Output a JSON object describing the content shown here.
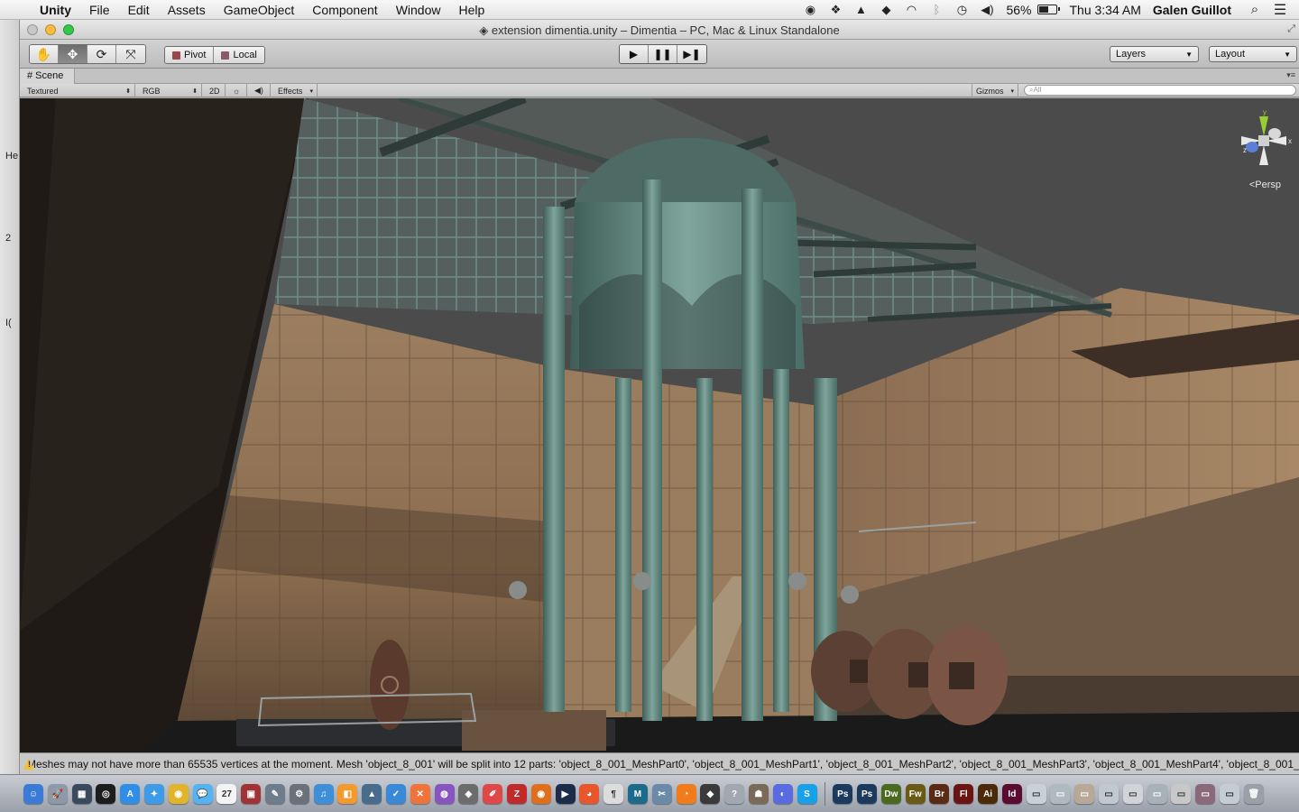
{
  "menubar": {
    "app": "Unity",
    "items": [
      "File",
      "Edit",
      "Assets",
      "GameObject",
      "Component",
      "Window",
      "Help"
    ],
    "battery_percent": "56%",
    "battery_level": 0.56,
    "clock": "Thu 3:34 AM",
    "user": "Galen Guillot",
    "status_icons": [
      "evernote-icon",
      "dropbox-icon",
      "google-drive-icon",
      "creative-cloud-icon",
      "wifi-icon",
      "bluetooth-icon",
      "time-machine-icon",
      "volume-icon"
    ]
  },
  "window": {
    "title": "extension dimentia.unity – Dimentia – PC, Mac & Linux Standalone"
  },
  "toolbar": {
    "tools": [
      "hand-tool",
      "move-tool",
      "rotate-tool",
      "scale-tool"
    ],
    "pivot_label": "Pivot",
    "local_label": "Local",
    "play_controls": [
      "play",
      "pause",
      "step"
    ],
    "layers_label": "Layers",
    "layout_label": "Layout"
  },
  "scene_tab": {
    "label": "Scene",
    "render_mode": "Textured",
    "color_mode": "RGB",
    "toggle_2d": "2D",
    "effects_label": "Effects",
    "gizmos_label": "Gizmos",
    "search_placeholder": "All",
    "camera_mode": "Persp",
    "axis_x": "x",
    "axis_y": "y",
    "axis_z": "z"
  },
  "behind_window_text": [
    "He",
    "2",
    "I("
  ],
  "console": {
    "message": "Meshes may not have more than 65535 vertices at the moment. Mesh 'object_8_001' will be split into 12 parts: 'object_8_001_MeshPart0', 'object_8_001_MeshPart1', 'object_8_001_MeshPart2', 'object_8_001_MeshPart3', 'object_8_001_MeshPart4', 'object_8_001_"
  },
  "dock": {
    "apps": [
      {
        "name": "finder",
        "color": "#3b7bd6",
        "glyph": "☺"
      },
      {
        "name": "launchpad",
        "color": "#8d98a8",
        "glyph": "🚀"
      },
      {
        "name": "mission-control",
        "color": "#3a4a5e",
        "glyph": "▦"
      },
      {
        "name": "dashboard",
        "color": "#1d1d1d",
        "glyph": "◎"
      },
      {
        "name": "app-store",
        "color": "#2f8fe8",
        "glyph": "A"
      },
      {
        "name": "safari",
        "color": "#3e9be8",
        "glyph": "✦"
      },
      {
        "name": "chrome",
        "color": "#e0b52a",
        "glyph": "◉"
      },
      {
        "name": "messages",
        "color": "#55b3f3",
        "glyph": "💬"
      },
      {
        "name": "calendar",
        "color": "#f4f4f4",
        "glyph": "27"
      },
      {
        "name": "photo-booth",
        "color": "#a03434",
        "glyph": "▣"
      },
      {
        "name": "preview",
        "color": "#6d7d8c",
        "glyph": "✎"
      },
      {
        "name": "system-preferences",
        "color": "#6b7079",
        "glyph": "⚙"
      },
      {
        "name": "itunes",
        "color": "#3f8fd8",
        "glyph": "♫"
      },
      {
        "name": "ibooks",
        "color": "#f29a2e",
        "glyph": "◧"
      },
      {
        "name": "iphoto",
        "color": "#4a6c8c",
        "glyph": "▲"
      },
      {
        "name": "wunderlist",
        "color": "#3a88d8",
        "glyph": "✓"
      },
      {
        "name": "xampp",
        "color": "#f0743a",
        "glyph": "✕"
      },
      {
        "name": "transmit",
        "color": "#8854c0",
        "glyph": "◍"
      },
      {
        "name": "network-utility",
        "color": "#6c6c6c",
        "glyph": "◈"
      },
      {
        "name": "script-editor",
        "color": "#e04848",
        "glyph": "✐"
      },
      {
        "name": "filezilla",
        "color": "#c02a2a",
        "glyph": "Z"
      },
      {
        "name": "sublime",
        "color": "#e06e1e",
        "glyph": "◉"
      },
      {
        "name": "quicktime",
        "color": "#1e2c4c",
        "glyph": "▶"
      },
      {
        "name": "firefox",
        "color": "#e8562c",
        "glyph": "◕"
      },
      {
        "name": "textedit",
        "color": "#dcdcdc",
        "glyph": "¶"
      },
      {
        "name": "maya",
        "color": "#1c6b8a",
        "glyph": "M"
      },
      {
        "name": "blender-tools",
        "color": "#6a8aa8",
        "glyph": "✂"
      },
      {
        "name": "blender",
        "color": "#f07c1c",
        "glyph": "◔"
      },
      {
        "name": "unity",
        "color": "#3a3a3a",
        "glyph": "◆"
      },
      {
        "name": "help",
        "color": "#a0a8b0",
        "glyph": "?"
      },
      {
        "name": "automator",
        "color": "#7a6a58",
        "glyph": "☗"
      },
      {
        "name": "flash-player",
        "color": "#5a6ae0",
        "glyph": "◐"
      },
      {
        "name": "skype",
        "color": "#18a0e8",
        "glyph": "S"
      },
      {
        "name": "photoshop",
        "color": "#1b3a5e",
        "glyph": "Ps"
      },
      {
        "name": "photoshop-cc",
        "color": "#1b3a5e",
        "glyph": "Ps"
      },
      {
        "name": "dreamweaver",
        "color": "#4a6a20",
        "glyph": "Dw"
      },
      {
        "name": "fireworks",
        "color": "#6a5a14",
        "glyph": "Fw"
      },
      {
        "name": "bridge",
        "color": "#5a2a14",
        "glyph": "Br"
      },
      {
        "name": "flash",
        "color": "#6a1414",
        "glyph": "Fl"
      },
      {
        "name": "illustrator",
        "color": "#4a2a08",
        "glyph": "Ai"
      },
      {
        "name": "indesign",
        "color": "#5a0c30",
        "glyph": "Id"
      },
      {
        "name": "stack-1",
        "color": "#c8d0d8",
        "glyph": "▭"
      },
      {
        "name": "stack-2",
        "color": "#b0b8c0",
        "glyph": "▭"
      },
      {
        "name": "stack-3",
        "color": "#b8a898",
        "glyph": "▭"
      },
      {
        "name": "stack-4",
        "color": "#c0c8d0",
        "glyph": "▭"
      },
      {
        "name": "stack-5",
        "color": "#d0d4d8",
        "glyph": "▭"
      },
      {
        "name": "stack-6",
        "color": "#a8b0b8",
        "glyph": "▭"
      },
      {
        "name": "stack-7",
        "color": "#c8c8c8",
        "glyph": "▭"
      },
      {
        "name": "stack-8",
        "color": "#8a6a7a",
        "glyph": "▭"
      },
      {
        "name": "stack-9",
        "color": "#c4ccd4",
        "glyph": "▭"
      },
      {
        "name": "trash",
        "color": "#9aa0a8",
        "glyph": "🗑"
      }
    ]
  }
}
